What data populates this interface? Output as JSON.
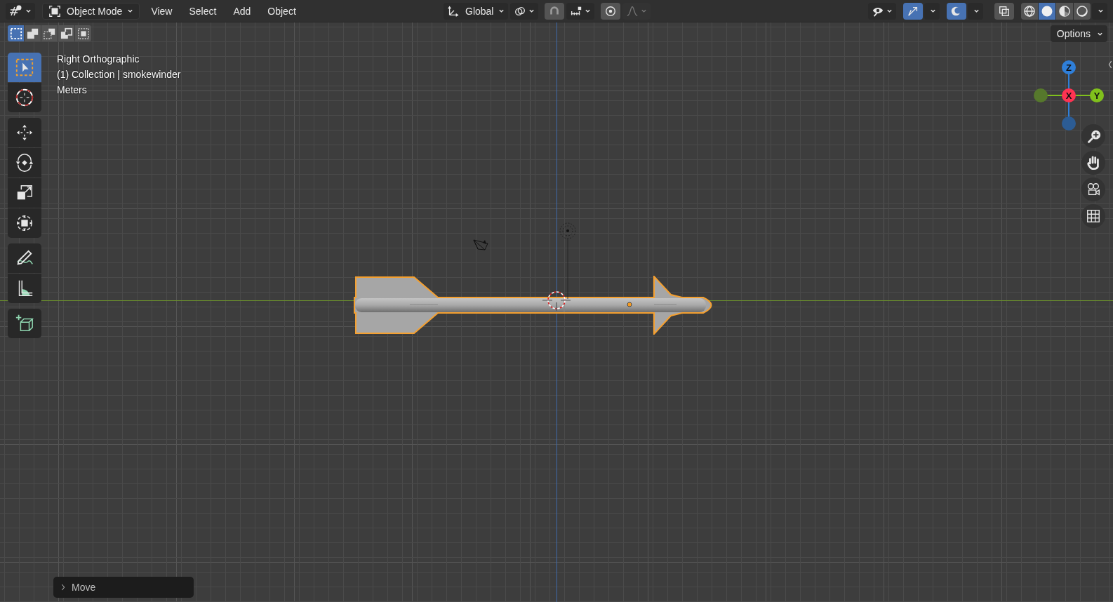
{
  "header": {
    "mode": {
      "label": "Object Mode"
    },
    "menus": [
      {
        "label": "View"
      },
      {
        "label": "Select"
      },
      {
        "label": "Add"
      },
      {
        "label": "Object"
      }
    ],
    "orientation": {
      "label": "Global"
    },
    "snap": {
      "on": false
    },
    "proportional_editing": {
      "on": false
    },
    "gizmos": {
      "on": true
    },
    "overlays": {
      "on": true
    },
    "xray": {
      "on": false
    },
    "shading": [
      {
        "kind": "wireframe",
        "selected": false
      },
      {
        "kind": "solid",
        "selected": true
      },
      {
        "kind": "material",
        "selected": false
      },
      {
        "kind": "rendered",
        "selected": false
      }
    ]
  },
  "select_modes": [
    {
      "kind": "new",
      "selected": true
    },
    {
      "kind": "extend",
      "selected": false
    },
    {
      "kind": "subtract",
      "selected": false
    },
    {
      "kind": "invert",
      "selected": false
    },
    {
      "kind": "intersect",
      "selected": false
    }
  ],
  "options": {
    "label": "Options"
  },
  "tool_groups": [
    [
      {
        "kind": "select_box",
        "selected": true
      },
      {
        "kind": "cursor",
        "selected": false
      }
    ],
    [
      {
        "kind": "move",
        "selected": false
      },
      {
        "kind": "rotate",
        "selected": false
      },
      {
        "kind": "scale",
        "selected": false
      },
      {
        "kind": "transform",
        "selected": false
      }
    ],
    [
      {
        "kind": "annotate",
        "selected": false
      },
      {
        "kind": "measure",
        "selected": false
      }
    ],
    [
      {
        "kind": "add_cube",
        "selected": false
      }
    ]
  ],
  "viewport_info": [
    "Right Orthographic",
    "(1) Collection | smokewinder",
    "Meters"
  ],
  "navigation_gizmo": [
    {
      "kind": "pos_z",
      "label": "Z",
      "color": "#2f7fd9"
    },
    {
      "kind": "neg_y",
      "color": "#56782c"
    },
    {
      "kind": "pos_x",
      "label": "X",
      "color": "#ff3352"
    },
    {
      "kind": "pos_y",
      "label": "Y",
      "color": "#80c01c"
    },
    {
      "kind": "neg_z",
      "color": "#2c5c94"
    }
  ],
  "navigation_buttons": [
    {
      "kind": "zoom"
    },
    {
      "kind": "pan"
    },
    {
      "kind": "camera"
    },
    {
      "kind": "grid"
    }
  ],
  "last_operator": {
    "label": "Move"
  }
}
